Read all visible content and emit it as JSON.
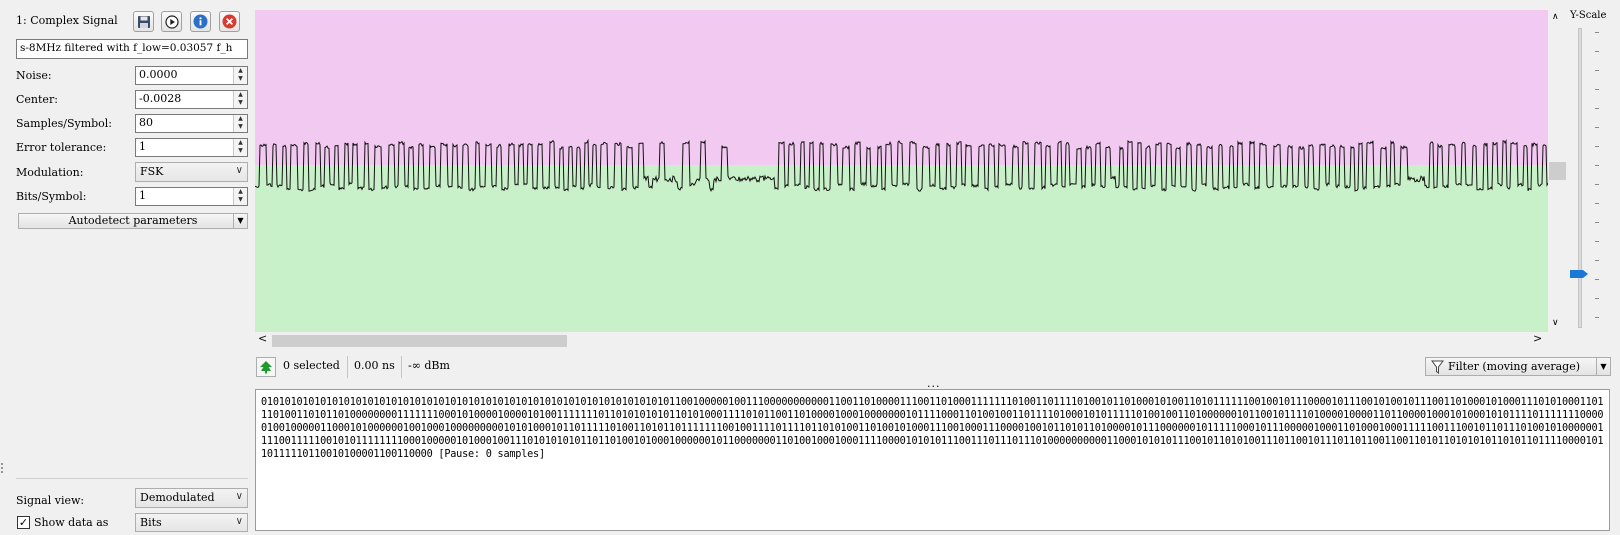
{
  "signal": {
    "title": "1: Complex Signal",
    "name": "s-8MHz filtered with f_low=0.03057 f_h"
  },
  "toolbar": {
    "save_icon": "save-icon",
    "play_icon": "play-icon",
    "info_icon": "info-icon",
    "close_icon": "close-icon"
  },
  "params": {
    "noise_label": "Noise:",
    "noise_value": "0.0000",
    "center_label": "Center:",
    "center_value": "-0.0028",
    "sps_label": "Samples/Symbol:",
    "sps_value": "80",
    "tolerance_label": "Error tolerance:",
    "tolerance_value": "1",
    "modulation_label": "Modulation:",
    "modulation_value": "FSK",
    "bits_label": "Bits/Symbol:",
    "bits_value": "1",
    "autodetect_label": "Autodetect parameters"
  },
  "view": {
    "signal_view_label": "Signal view:",
    "signal_view_value": "Demodulated",
    "show_data_label": "Show data as",
    "show_data_value": "Bits",
    "show_data_checked": true
  },
  "plot": {
    "top_color": "#f1c9f1",
    "bottom_color": "#c9f1c9",
    "center_fraction": 0.48
  },
  "yscale": {
    "label": "Y-Scale",
    "level": 0.82
  },
  "status": {
    "selected": "0 selected",
    "time": "0.00 ns",
    "power": "-∞ dBm",
    "filter": "Filter (moving average)",
    "splitter_dots": "..."
  },
  "bits": {
    "text": "0101010101010101010101010101010101010101010101010101010101010101010101100100000100111000000000001100110100001110011010001111111010011011110100101101000101001101011111100100101110000101110010100101110011010001010001110101000110111010011010110100000000111111100010100001000010100111111101101010101011010100011110101100110100001000100000001011110001101001001101111010001010111110100100110100000010110010111101000010000110110000100010100010101111011111110000010010000011000101000000100100010000000001010100010110111110100110101101111111001001111011110110101001101001010001110010001110000100101101011010000101110000001011111000101110000010001101000100011111001110010110111010010100000011110011111001010111111110001000001010001001110101010101101101001010001000000101100000001101001000100011110000101010111001110111011101000000000011000101010111001011010100111011001011101101100110011010110101010110101101111000010110111110110010100001100110000",
    "pause": "[Pause: 0 samples]"
  }
}
